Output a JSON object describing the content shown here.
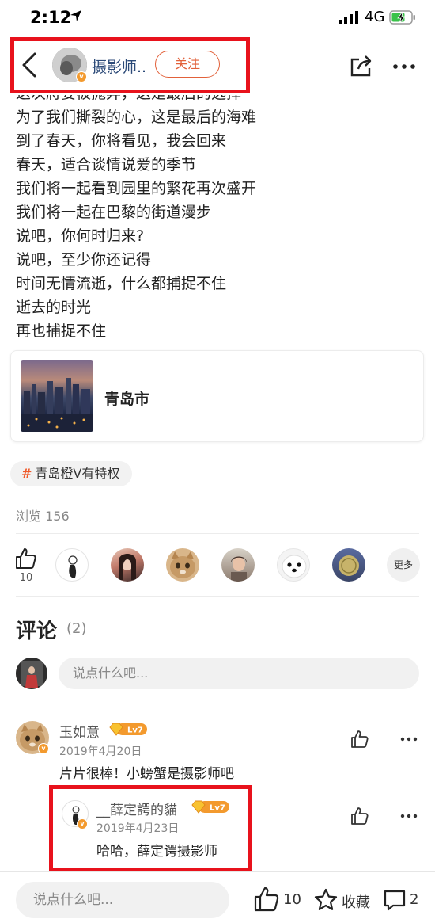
{
  "status_bar": {
    "time": "2:12",
    "network": "4G",
    "icons": [
      "location-arrow-icon",
      "signal-icon",
      "battery-charging-icon"
    ]
  },
  "navbar": {
    "author_name": "摄影师..",
    "follow_label": "关注",
    "icons": [
      "back-chevron-icon",
      "share-icon",
      "more-dots-icon"
    ]
  },
  "article": {
    "lines": [
      "这次將要被抛弃，这是最后的选择",
      "为了我们撕裂的心，这是最后的海难",
      "到了春天，你将看见，我会回来",
      "春天，适合谈情说爱的季节",
      "我们将一起看到园里的繁花再次盛开",
      "我们将一起在巴黎的街道漫步",
      "说吧，你何时归来?",
      "说吧，至少你还记得",
      "时间无情流逝，什么都捕捉不住",
      "逝去的时光",
      "再也捕捉不住"
    ]
  },
  "location": {
    "name": "青岛市"
  },
  "topic": {
    "hash": "#",
    "label": "青岛橙V有特权"
  },
  "views": {
    "label": "浏览 156"
  },
  "likes": {
    "count": "10",
    "more_label": "更多"
  },
  "comments": {
    "title": "评论",
    "count": "(2)",
    "input_placeholder": "说点什么吧...",
    "items": [
      {
        "name": "玉如意",
        "level": "Lv7",
        "date": "2019年4月20日",
        "text": "片片很棒！小螃蟹是摄影师吧"
      },
      {
        "name": "__薛定諤的貓",
        "level": "Lv7",
        "date": "2019年4月23日",
        "text": "哈哈，薛定谔摄影师"
      }
    ]
  },
  "bottom_bar": {
    "input_placeholder": "说点什么吧...",
    "like_count": "10",
    "favorite_label": "收藏",
    "comment_count": "2"
  },
  "colors": {
    "accent": "#e2613a",
    "highlight": "#e8121c",
    "author_name": "#2c4a78",
    "level_badge": "#f39a2e"
  }
}
